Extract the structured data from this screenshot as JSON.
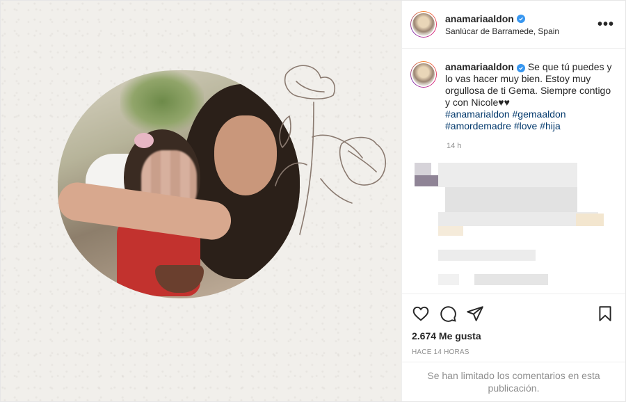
{
  "post": {
    "username": "anamariaaldon",
    "location": "Sanlúcar de Barramede, Spain",
    "caption": {
      "text": "Se que tú puedes y lo vas hacer muy bien. Estoy muy orgullosa de ti Gema. Siempre contigo y con Nicole♥♥",
      "hashtags_line1": "#anamarialdon #gemaaldon",
      "hashtags_line2": "#amordemadre #love #hija"
    },
    "comment_time": "14 h",
    "likes": "2.674 Me gusta",
    "age": "HACE 14 HORAS",
    "comments_limited": "Se han limitado los comentarios en esta publicación."
  },
  "icons": {
    "more": "more-options-icon",
    "like": "heart-icon",
    "comment": "comment-icon",
    "share": "share-icon",
    "save": "bookmark-icon",
    "verified": "verified-badge-icon"
  },
  "colors": {
    "verified": "#3897f0",
    "hashtag": "#00376b",
    "muted": "#8e8e8e"
  }
}
